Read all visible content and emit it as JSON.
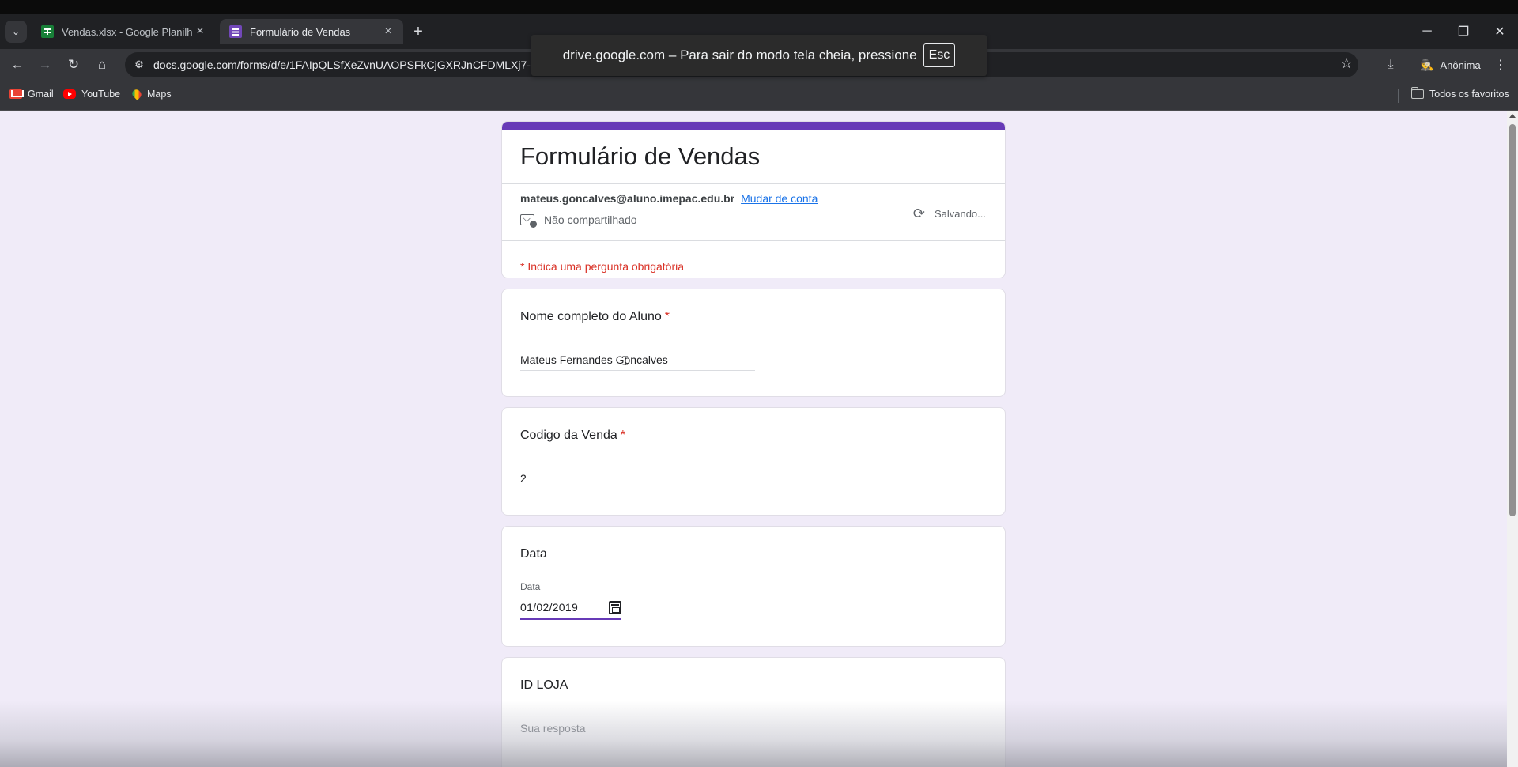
{
  "browser": {
    "tabs": [
      {
        "title": "Vendas.xlsx - Google Planilhas",
        "icon": "sheets-icon",
        "active": false
      },
      {
        "title": "Formulário de Vendas",
        "icon": "forms-icon",
        "active": true
      }
    ],
    "url": "docs.google.com/forms/d/e/1FAIpQLSfXeZvnUAOPSFkCjGXRJnCFDMLXj7-Yp6",
    "incognito_label": "Anônima",
    "bookmarks": [
      "Gmail",
      "YouTube",
      "Maps"
    ],
    "all_bookmarks_label": "Todos os favoritos",
    "fullscreen_notice": {
      "text": "drive.google.com – Para sair do modo tela cheia, pressione",
      "key": "Esc"
    }
  },
  "form": {
    "title": "Formulário de Vendas",
    "accent_color": "#673ab7",
    "account_email": "mateus.goncalves@aluno.imepac.edu.br",
    "switch_account": "Mudar de conta",
    "not_shared": "Não compartilhado",
    "saving_status": "Salvando...",
    "required_note": "* Indica uma pergunta obrigatória",
    "questions": [
      {
        "title": "Nome completo do Aluno",
        "required": "*",
        "value": "Mateus Fernandes Goncalves"
      },
      {
        "title": "Codigo da Venda",
        "required": "*",
        "value": "2"
      },
      {
        "title": "Data",
        "sublabel": "Data",
        "value": "01/02/2019"
      },
      {
        "title": "ID LOJA",
        "placeholder": "Sua resposta"
      }
    ]
  }
}
